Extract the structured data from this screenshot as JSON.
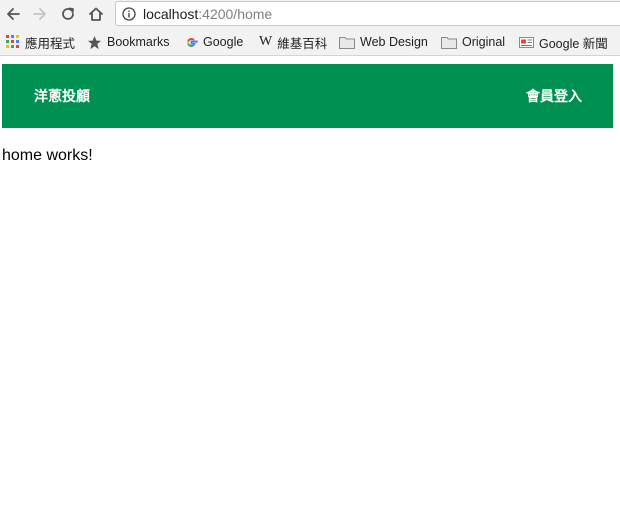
{
  "browser": {
    "url_host": "localhost",
    "url_rest": ":4200/home"
  },
  "bookmarks": [
    {
      "label": "應用程式",
      "icon": "apps-grid-icon"
    },
    {
      "label": "Bookmarks",
      "icon": "star-icon"
    },
    {
      "label": "Google",
      "icon": "google-g-icon"
    },
    {
      "label": "維基百科",
      "icon": "wikipedia-w-icon"
    },
    {
      "label": "Web Design",
      "icon": "folder-icon"
    },
    {
      "label": "Original",
      "icon": "folder-icon"
    },
    {
      "label": "Google 新聞",
      "icon": "google-news-icon"
    }
  ],
  "header": {
    "brand": "洋蔥投顧",
    "login": "會員登入",
    "color": "#009051"
  },
  "main": {
    "text": "home works!"
  }
}
